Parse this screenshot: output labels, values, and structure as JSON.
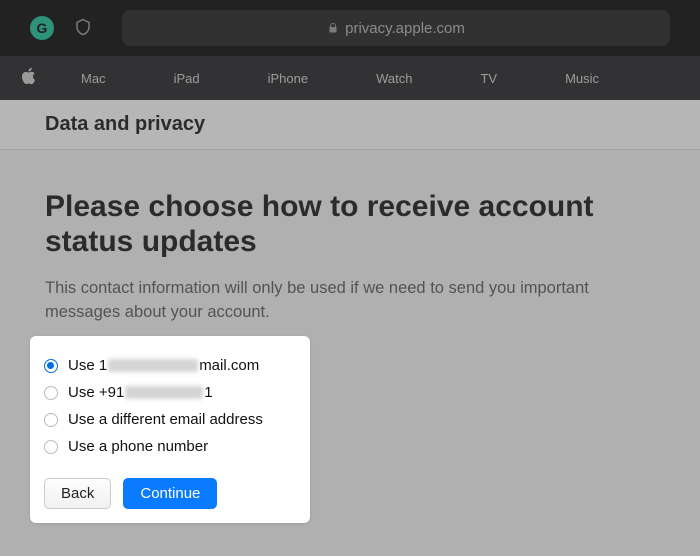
{
  "browser": {
    "url_display": "privacy.apple.com"
  },
  "nav": {
    "items": [
      "Mac",
      "iPad",
      "iPhone",
      "Watch",
      "TV",
      "Music"
    ]
  },
  "subbar": {
    "title": "Data and privacy"
  },
  "page": {
    "heading": "Please choose how to receive account status updates",
    "subtext": "This contact information will only be used if we need to send you important messages about your account."
  },
  "options": {
    "opt1_prefix": "Use 1",
    "opt1_suffix": "mail.com",
    "opt2_prefix": "Use +91",
    "opt2_suffix": "1",
    "opt3": "Use a different email address",
    "opt4": "Use a phone number",
    "selected": 0
  },
  "buttons": {
    "back": "Back",
    "continue": "Continue"
  }
}
